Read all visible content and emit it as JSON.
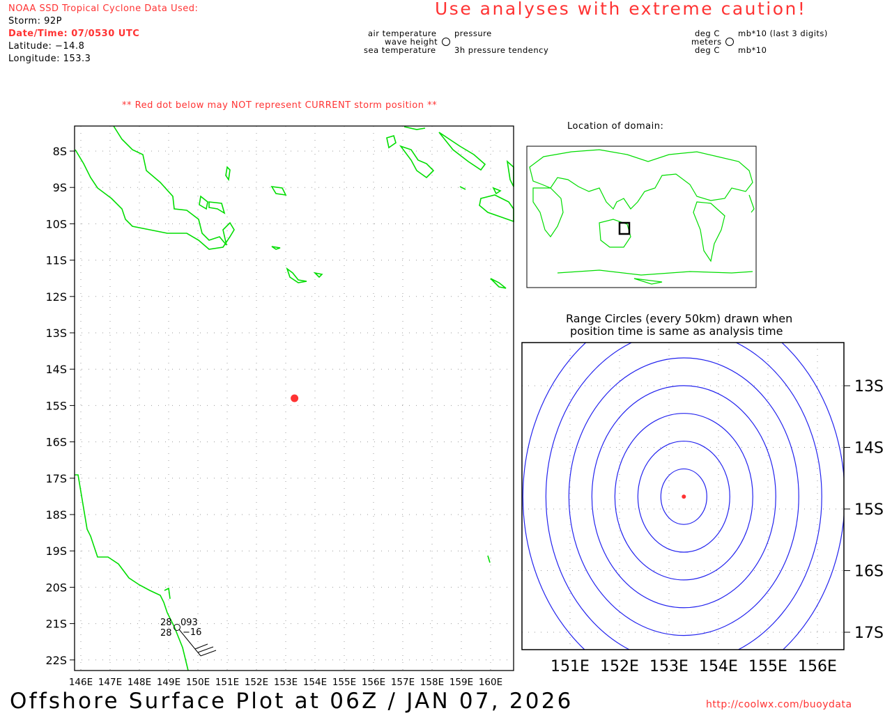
{
  "header": {
    "source_title": "NOAA SSD Tropical Cyclone Data Used:",
    "storm": "Storm: 92P",
    "datetime": "Date/Time: 07/0530 UTC",
    "latitude": "Latitude: −14.8",
    "longitude": "Longitude: 153.3",
    "caution": "Use analyses with extreme caution!",
    "red_dot_note": "** Red dot below may NOT represent CURRENT storm position **"
  },
  "legend": {
    "left": {
      "air_temp": "air temperature",
      "wave_height": "wave height",
      "sea_temp": "sea temperature",
      "pressure": "pressure",
      "tendency": "3h pressure tendency"
    },
    "right": {
      "air_temp": "deg C",
      "wave_height": "meters",
      "sea_temp": "deg C",
      "pressure": "mb*10 (last 3 digits)",
      "tendency": "mb*10"
    }
  },
  "main_map": {
    "lon_labels": [
      "146E",
      "147E",
      "148E",
      "149E",
      "150E",
      "151E",
      "152E",
      "153E",
      "154E",
      "155E",
      "156E",
      "157E",
      "158E",
      "159E",
      "160E"
    ],
    "lon_values": [
      146,
      147,
      148,
      149,
      150,
      151,
      152,
      153,
      154,
      155,
      156,
      157,
      158,
      159,
      160
    ],
    "lat_labels": [
      "8S",
      "9S",
      "10S",
      "11S",
      "12S",
      "13S",
      "14S",
      "15S",
      "16S",
      "17S",
      "18S",
      "19S",
      "20S",
      "21S",
      "22S"
    ],
    "lat_values": [
      8,
      9,
      10,
      11,
      12,
      13,
      14,
      15,
      16,
      17,
      18,
      19,
      20,
      21,
      22
    ],
    "storm_position": {
      "lat": -14.8,
      "lon": 153.3
    },
    "station": {
      "air_temp": "28",
      "sea_temp": "28",
      "pressure": "093",
      "tendency": "−16"
    }
  },
  "inset": {
    "title": "Location of domain:"
  },
  "range_panel": {
    "title_line1": "Range Circles (every 50km) drawn when",
    "title_line2": "position time is same as analysis time",
    "lon_labels": [
      "151E",
      "152E",
      "153E",
      "154E",
      "155E",
      "156E"
    ],
    "lon_values": [
      151,
      152,
      153,
      154,
      155,
      156
    ],
    "lat_labels": [
      "13S",
      "14S",
      "15S",
      "16S",
      "17S"
    ],
    "lat_values": [
      13,
      14,
      15,
      16,
      17
    ],
    "circle_spacing_km": 50
  },
  "footer": {
    "title": "Offshore Surface Plot at 06Z / JAN 07, 2026",
    "url": "http://coolwx.com/buoydata"
  },
  "colors": {
    "red": "#ff3333",
    "coast": "#00dd00",
    "circles": "#2222ee"
  }
}
